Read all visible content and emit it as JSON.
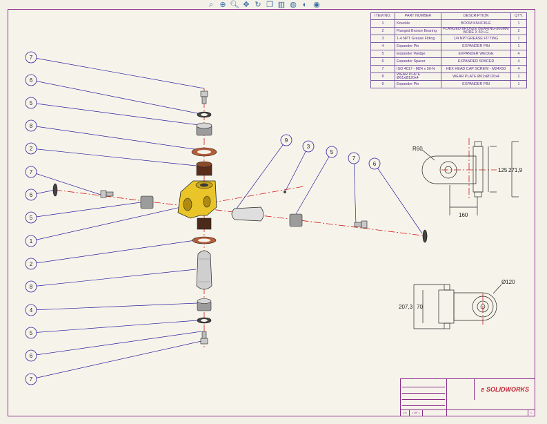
{
  "toolbar": {
    "icons": [
      "zoom-to-fit-icon",
      "zoom-area-icon",
      "zoom-icon",
      "pan-icon",
      "rotate-icon",
      "view-orientation-icon",
      "display-style-icon",
      "hide-show-icon",
      "appearance-icon",
      "scene-icon"
    ]
  },
  "bom": {
    "headers": [
      "ITEM NO.",
      "PART NUMBER",
      "DESCRIPTION",
      "QTY."
    ],
    "rows": [
      {
        "item": "1",
        "part": "Knuckle",
        "desc": "BOOM KNUCKLE",
        "qty": "1"
      },
      {
        "item": "2",
        "part": "Flanged Bronze Bearing",
        "desc": "FLANGED BRONZE BEARING-ø60MM BORE X 50 LG",
        "qty": "2"
      },
      {
        "item": "3",
        "part": "1-4 NPT Grease Fitting",
        "desc": "1/4 NPTGREASE FITTING",
        "qty": "1"
      },
      {
        "item": "4",
        "part": "Expander Pin",
        "desc": "EXPANDER PIN",
        "qty": "1"
      },
      {
        "item": "5",
        "part": "Expander Wedge",
        "desc": "EXPANDER WEDGE",
        "qty": "4"
      },
      {
        "item": "6",
        "part": "Expander Spacer",
        "desc": "EXPANDER SPACER",
        "qty": "4"
      },
      {
        "item": "7",
        "part": "ISO 4017 - M24 x 50-N",
        "desc": "HEX HEAD CAP SCREW - M24X50",
        "qty": "4"
      },
      {
        "item": "8",
        "part": "WEAR PLATE Ø61xØ120x4",
        "desc": "WEAR PLATE Ø61xØ120x4",
        "qty": "2"
      },
      {
        "item": "9",
        "part": "Expander Pin",
        "desc": "EXPANDER PIN",
        "qty": "1"
      }
    ]
  },
  "balloons": [
    "7",
    "6",
    "5",
    "8",
    "2",
    "7",
    "6",
    "5",
    "1",
    "2",
    "8",
    "4",
    "5",
    "6",
    "7",
    "9",
    "3",
    "5",
    "7",
    "6"
  ],
  "dimensions": {
    "radius": "R60",
    "height_inner": "125",
    "height_outer": "271,9",
    "width": "160",
    "diameter": "Ø120",
    "front_outer": "207,3",
    "front_inner": "70"
  },
  "title_block": {
    "brand": "SOLIDWORKS",
    "size": "1:5",
    "sheet": "1 OF 1",
    "rev": "C"
  },
  "colors": {
    "border": "#8b2a8b",
    "balloon": "#2b1fa0",
    "centerline": "#d01414",
    "part_yellow": "#e9c52a",
    "bom_text": "#5b2e8f"
  }
}
